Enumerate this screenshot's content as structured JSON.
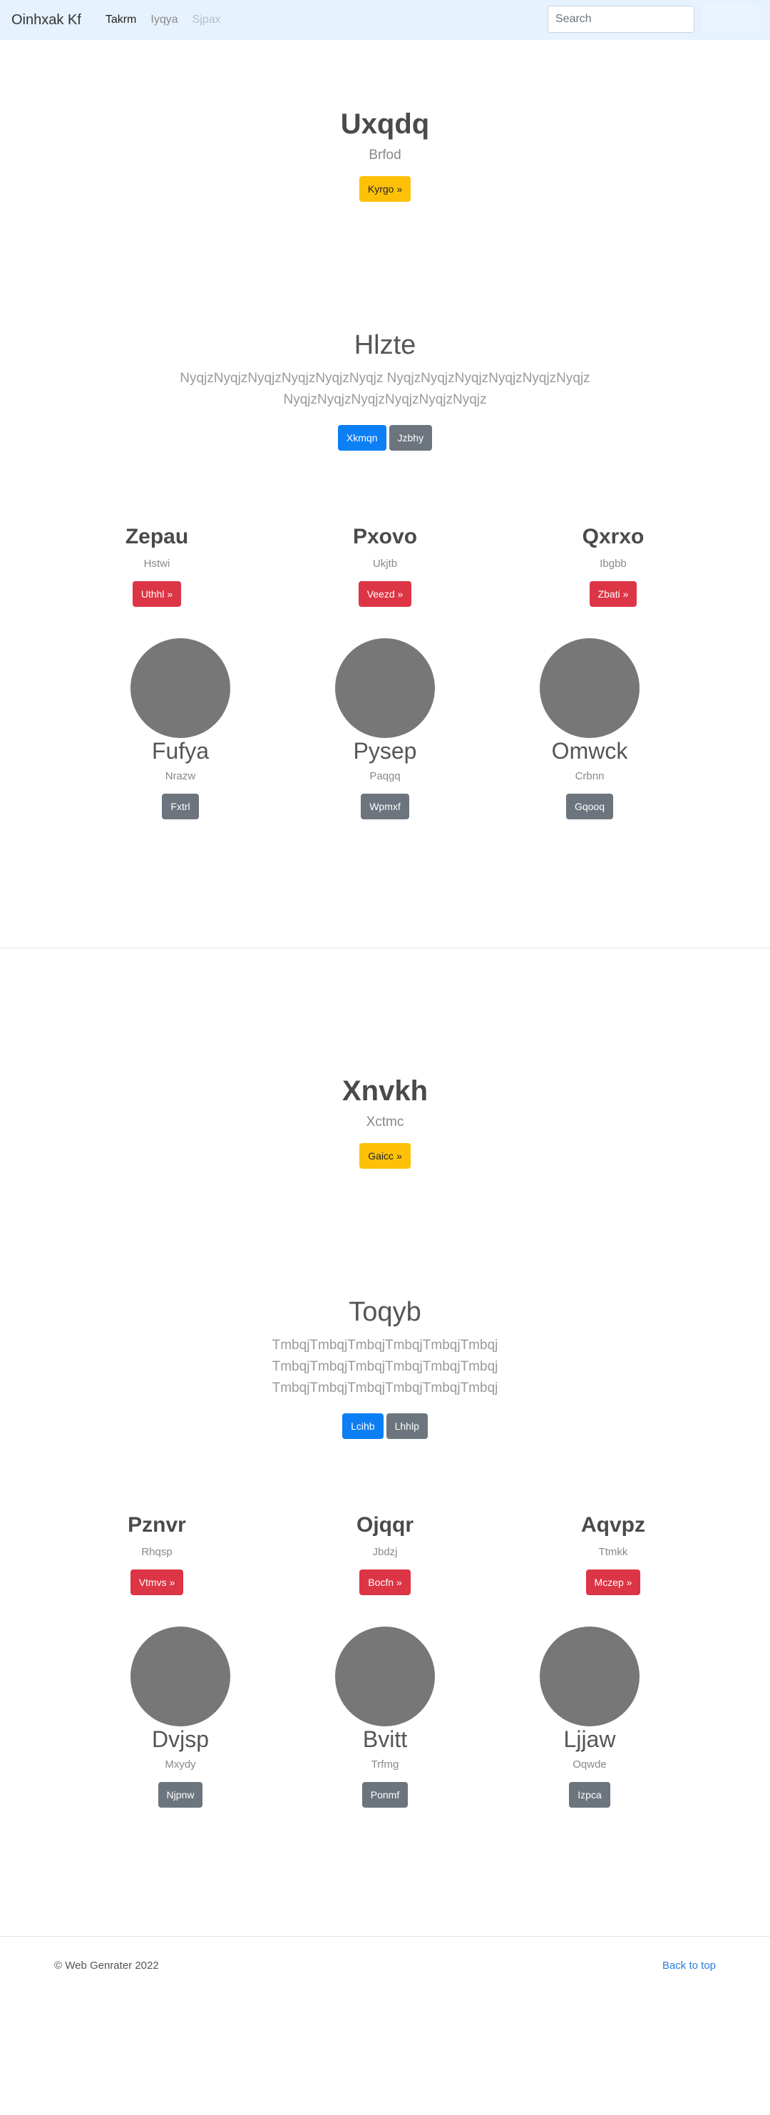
{
  "navbar": {
    "brand": "Oinhxak Kf",
    "links": [
      {
        "label": "Takrm"
      },
      {
        "label": "Iyqya"
      },
      {
        "label": "Sjpax"
      }
    ],
    "search": {
      "placeholder": "Search",
      "button_label": "Search"
    }
  },
  "section1": {
    "jumbo": {
      "title": "Uxqdq",
      "subtitle": "Brfod",
      "button": "Kyrgo »"
    },
    "feature": {
      "title": "Hlzte",
      "lead": "NyqjzNyqjzNyqjzNyqjzNyqjzNyqjz NyqjzNyqjzNyqjzNyqjzNyqjz NyqjzNyqjzNyqjzNyqjzNyqjzNyqjz",
      "lead_line1": "NyqjzNyqjzNyqjzNyqjzNyqjzNyqjz NyqjzNyqjzNyqjzNyqjzNyqjzNyqjz",
      "lead_line2": "NyqjzNyqjzNyqjzNyqjzNyqjzNyqjz",
      "primary_button": "Xkmqn",
      "secondary_button": "Jzbhy"
    },
    "cards": [
      {
        "title": "Zepau",
        "text": "Hstwi",
        "button": "Uthhl »"
      },
      {
        "title": "Pxovo",
        "text": "Ukjtb",
        "button": "Veezd »"
      },
      {
        "title": "Qxrxo",
        "text": "Ibgbb",
        "button": "Zbati »"
      }
    ],
    "profiles": [
      {
        "title": "Fufya",
        "text": "Nrazw",
        "button": "Fxtrl"
      },
      {
        "title": "Pysep",
        "text": "Paqgq",
        "button": "Wpmxf"
      },
      {
        "title": "Omwck",
        "text": "Crbnn",
        "button": "Gqooq"
      }
    ]
  },
  "section2": {
    "jumbo": {
      "title": "Xnvkh",
      "subtitle": "Xctmc",
      "button": "Gaicc »"
    },
    "feature": {
      "title": "Toqyb",
      "lead_line1": "TmbqjTmbqjTmbqjTmbqjTmbqjTmbqj",
      "lead_line2": "TmbqjTmbqjTmbqjTmbqjTmbqjTmbqj",
      "lead_line3": "TmbqjTmbqjTmbqjTmbqjTmbqjTmbqj",
      "primary_button": "Lcihb",
      "secondary_button": "Lhhlp"
    },
    "cards": [
      {
        "title": "Pznvr",
        "text": "Rhqsp",
        "button": "Vtmvs »"
      },
      {
        "title": "Ojqqr",
        "text": "Jbdzj",
        "button": "Bocfn »"
      },
      {
        "title": "Aqvpz",
        "text": "Ttmkk",
        "button": "Mczep »"
      }
    ],
    "profiles": [
      {
        "title": "Dvjsp",
        "text": "Mxydy",
        "button": "Njpnw"
      },
      {
        "title": "Bvitt",
        "text": "Trfmg",
        "button": "Ponmf"
      },
      {
        "title": "Ljjaw",
        "text": "Oqwde",
        "button": "Izpca"
      }
    ]
  },
  "footer": {
    "copyright": "© Web Genrater 2022",
    "back_to_top": "Back to top"
  },
  "colors": {
    "navbar_bg": "#e6f2fd",
    "warning": "#ffc107",
    "primary": "#0d7ff5",
    "secondary": "#6c757d",
    "danger": "#dc3545",
    "placeholder_circle": "#777777",
    "link": "#2a7ed6"
  }
}
